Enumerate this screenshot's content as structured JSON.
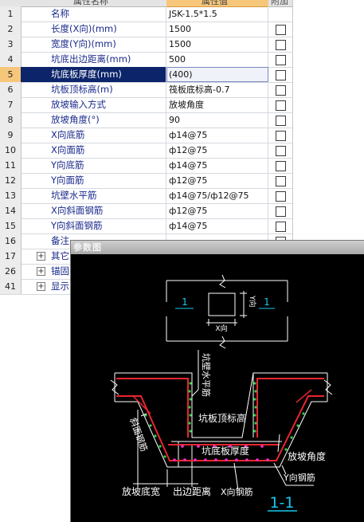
{
  "grid": {
    "header": {
      "name_col": "属性名称",
      "value_col": "属性值",
      "extra_col": "附加"
    },
    "rows": [
      {
        "num": "1",
        "name": "名称",
        "value": "JSK-1.5*1.5",
        "checkbox": false
      },
      {
        "num": "2",
        "name": "长度(X向)(mm)",
        "value": "1500",
        "checkbox": true
      },
      {
        "num": "3",
        "name": "宽度(Y向)(mm)",
        "value": "1500",
        "checkbox": true
      },
      {
        "num": "4",
        "name": "坑底出边距离(mm)",
        "value": "500",
        "checkbox": true
      },
      {
        "num": "5",
        "name": "坑底板厚度(mm)",
        "value": "(400)",
        "checkbox": true,
        "selected": true
      },
      {
        "num": "6",
        "name": "坑板顶标高(m)",
        "value": "筏板底标高-0.7",
        "checkbox": true
      },
      {
        "num": "7",
        "name": "放坡输入方式",
        "value": "放坡角度",
        "checkbox": true
      },
      {
        "num": "8",
        "name": "放坡角度(°)",
        "value": "90",
        "checkbox": true
      },
      {
        "num": "9",
        "name": "X向底筋",
        "value": "ф14@75",
        "checkbox": true
      },
      {
        "num": "10",
        "name": "X向面筋",
        "value": "ф12@75",
        "checkbox": true
      },
      {
        "num": "11",
        "name": "Y向底筋",
        "value": "ф14@75",
        "checkbox": true
      },
      {
        "num": "12",
        "name": "Y向面筋",
        "value": "ф12@75",
        "checkbox": true
      },
      {
        "num": "13",
        "name": "坑壁水平筋",
        "value": "ф14@75/ф12@75",
        "checkbox": true
      },
      {
        "num": "14",
        "name": "X向斜面钢筋",
        "value": "ф12@75",
        "checkbox": true
      },
      {
        "num": "15",
        "name": "Y向斜面钢筋",
        "value": "ф14@75",
        "checkbox": true
      },
      {
        "num": "16",
        "name": "备注",
        "value": "",
        "checkbox": true
      }
    ],
    "groups": [
      {
        "num": "17",
        "name": "其它"
      },
      {
        "num": "26",
        "name": "锚固"
      },
      {
        "num": "41",
        "name": "显示"
      }
    ]
  },
  "param_window": {
    "title": "参数图",
    "plan": {
      "label_left": "1",
      "label_right": "1",
      "x_dim": "X向",
      "y_dim": "Y向"
    },
    "section": {
      "wall_bar": "坑壁水平筋",
      "top_elev": "坑板顶标高",
      "slope_bar": "斜面钢筋",
      "thickness": "坑底板厚度",
      "slope_angle": "放坡角度",
      "y_bar": "Y向钢筋",
      "slope_width": "放坡底宽",
      "edge_dist": "出边距离",
      "x_bar": "X向钢筋",
      "section_name": "1-1"
    },
    "colors": {
      "line": "#ffffff",
      "rebar": "#e8262e",
      "dot": "#ff2cc8",
      "hatch": "#2ad14a",
      "cyan": "#16c8ee"
    }
  }
}
